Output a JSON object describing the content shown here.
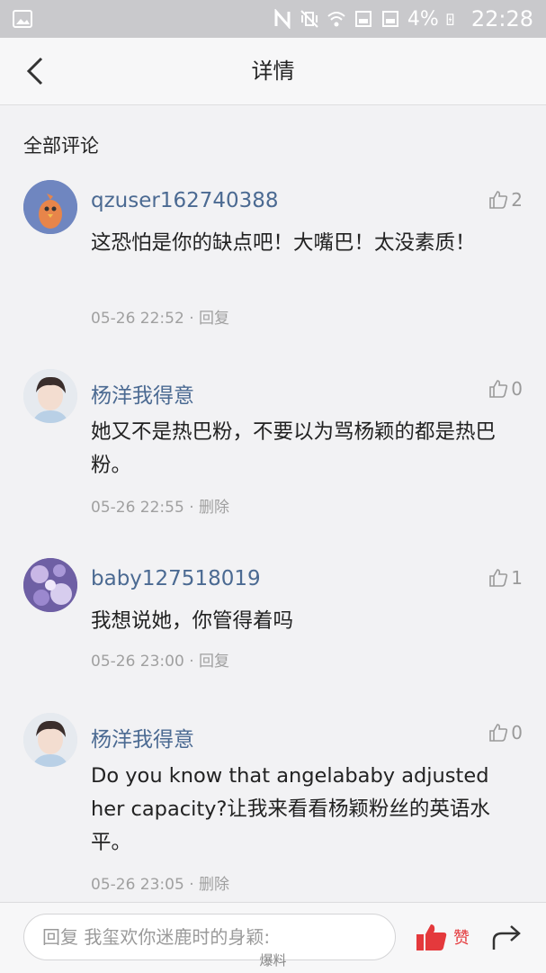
{
  "status_bar": {
    "battery_pct": "4%",
    "time": "22:28"
  },
  "header": {
    "title": "详情"
  },
  "section_title": "全部评论",
  "comments": [
    {
      "user": "qzuser162740388",
      "likes": "2",
      "body": "这恐怕是你的缺点吧！大嘴巴！太没素质！",
      "time": "05-26 22:52",
      "action": "回复"
    },
    {
      "user": "杨洋我得意",
      "likes": "0",
      "body": "她又不是热巴粉，不要以为骂杨颖的都是热巴粉。",
      "time": "05-26 22:55",
      "action": "删除"
    },
    {
      "user": "baby127518019",
      "likes": "1",
      "body": "我想说她，你管得着吗",
      "time": "05-26 23:00",
      "action": "回复"
    },
    {
      "user": "杨洋我得意",
      "likes": "0",
      "body": "Do you know that angelababy adjusted her capacity?让我来看看杨颖粉丝的英语水平。",
      "time": "05-26 23:05",
      "action": "删除"
    }
  ],
  "bottom_bar": {
    "reply_placeholder": "回复 我玺欢你迷鹿时的身颖:",
    "like_label": "赞"
  },
  "watermark": "爆料",
  "icons": {
    "back": "chevron-left-icon",
    "like": "thumbs-up-icon",
    "zan": "thumbs-up-filled-icon",
    "share": "share-arrow-icon"
  },
  "colors": {
    "username": "#4b6a92",
    "accent_red": "#e4393c",
    "meta": "#a0a0a0"
  }
}
